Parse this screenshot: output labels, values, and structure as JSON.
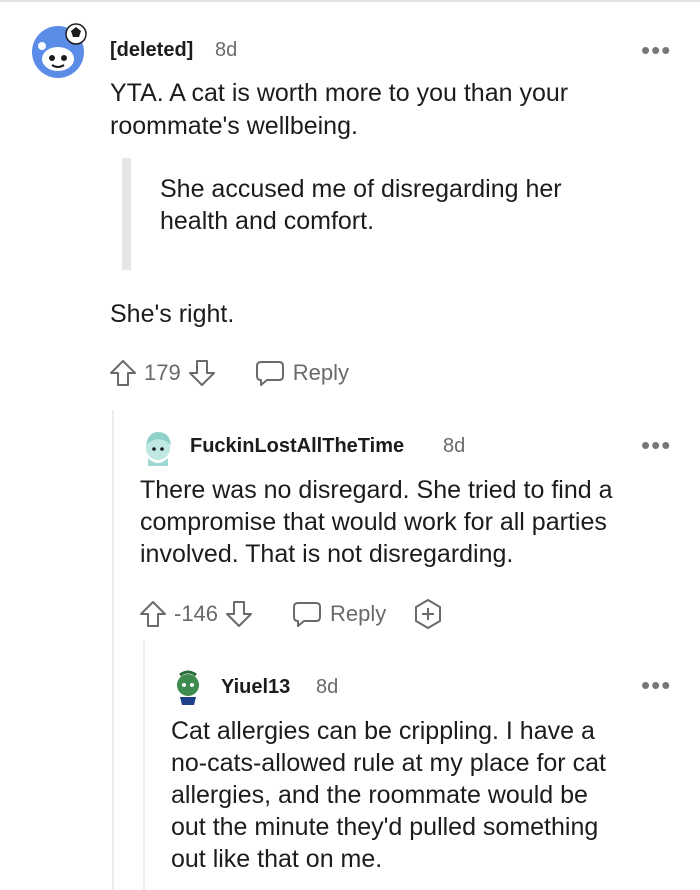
{
  "comments": [
    {
      "username": "[deleted]",
      "age": "8d",
      "body": [
        "YTA. A cat is worth more to you than your",
        "roommate's wellbeing."
      ],
      "quote": [
        "She accused me of disregarding her",
        "health and comfort."
      ],
      "body2": "She's right.",
      "score": "179",
      "reply_label": "Reply"
    },
    {
      "username": "FuckinLostAllTheTime",
      "age": "8d",
      "body": [
        "There was no disregard. She tried to find a",
        "compromise that would work for all parties",
        "involved. That is not disregarding."
      ],
      "score": "-146",
      "reply_label": "Reply"
    },
    {
      "username": "Yiuel13",
      "age": "8d",
      "body": [
        "Cat allergies can be crippling. I have a",
        "no-cats-allowed rule at my place for cat",
        "allergies, and the roommate would be",
        "out the minute they'd pulled something",
        "out like that on me."
      ]
    }
  ],
  "icons": {
    "more": "more-options-icon",
    "upvote": "upvote-arrow-icon",
    "downvote": "downvote-arrow-icon",
    "reply": "reply-bubble-icon",
    "expand": "expand-plus-icon"
  },
  "colors": {
    "avatar_blue": "#5b8de8",
    "avatar_teal": "#9fd8d2",
    "avatar_green": "#3e8b4f",
    "muted_text": "#6a6a6a"
  }
}
